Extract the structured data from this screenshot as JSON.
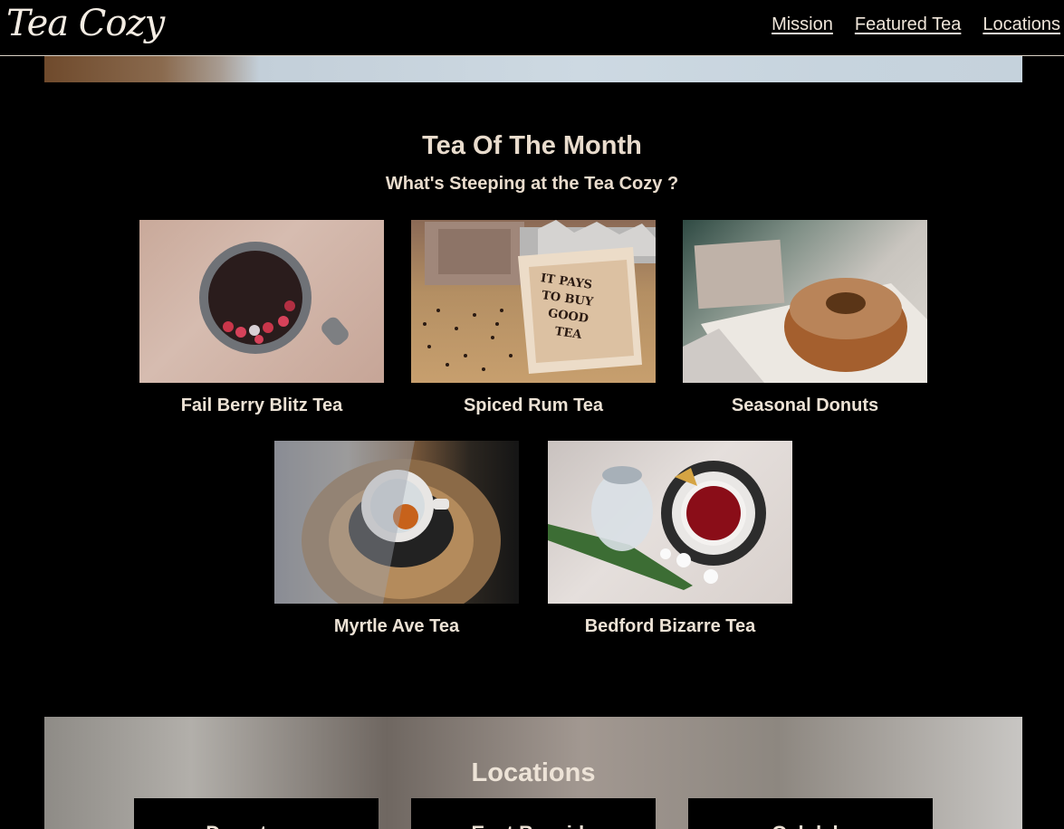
{
  "header": {
    "logo": "Tea Cozy",
    "nav": [
      "Mission",
      "Featured Tea",
      "Locations"
    ]
  },
  "tea_of_month": {
    "title": "Tea Of The Month",
    "subtitle": "What's Steeping at the Tea Cozy ?",
    "items": [
      {
        "label": "Fail Berry Blitz Tea",
        "image": "berry-mug-photo"
      },
      {
        "label": "Spiced Rum Tea",
        "image": "tea-box-photo"
      },
      {
        "label": "Seasonal Donuts",
        "image": "donut-photo"
      },
      {
        "label": "Myrtle Ave Tea",
        "image": "tea-cup-photo"
      },
      {
        "label": "Bedford Bizarre Tea",
        "image": "red-tea-photo"
      }
    ],
    "box_text": "IT PAYS TO BUY GOOD TEA"
  },
  "locations": {
    "title": "Locations",
    "cards": [
      "Downtown",
      "East Bayside",
      "Oakdale"
    ]
  }
}
